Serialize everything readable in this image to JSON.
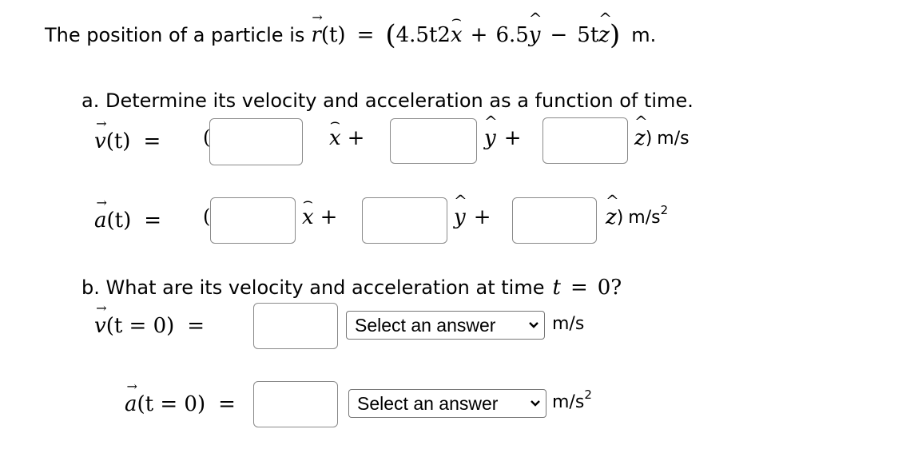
{
  "problem": {
    "intro_text": "The position of a particle is",
    "position_lhs": "r",
    "position_arg": "(t)",
    "equals": "=",
    "open_paren": "(",
    "term1_coef": "4.5t",
    "term1_exp": "2",
    "term1_unit_vec": "x",
    "plus1": "+",
    "term2_coef": "6.5",
    "term2_unit_vec": "y",
    "minus": "−",
    "term3_coef": "5t",
    "term3_unit_vec": "z",
    "close_paren": ")",
    "unit": "m."
  },
  "part_a": {
    "prompt": "a. Determine its velocity and acceleration as a function of time.",
    "velocity": {
      "lhs_symbol": "v",
      "lhs_arg": "(t)",
      "equals": "=",
      "open_paren": "(",
      "x_label": "x",
      "y_label": "y",
      "z_label": "z",
      "plus": "+",
      "close_paren": ")",
      "unit": "m/s",
      "inputs": [
        {
          "value": "",
          "placeholder": ""
        },
        {
          "value": "",
          "placeholder": ""
        },
        {
          "value": "",
          "placeholder": ""
        }
      ]
    },
    "acceleration": {
      "lhs_symbol": "a",
      "lhs_arg": "(t)",
      "equals": "=",
      "open_paren": "(",
      "x_label": "x",
      "y_label": "y",
      "z_label": "z",
      "plus": "+",
      "close_paren": ")",
      "unit": "m/s",
      "unit_exp": "2",
      "inputs": [
        {
          "value": "",
          "placeholder": ""
        },
        {
          "value": "",
          "placeholder": ""
        },
        {
          "value": "",
          "placeholder": ""
        }
      ]
    }
  },
  "part_b": {
    "prompt_text": "b. What are its velocity and acceleration at time",
    "prompt_var": "t",
    "prompt_eq": "=",
    "prompt_val": "0?",
    "velocity": {
      "lhs_symbol": "v",
      "lhs_arg": "(t = 0)",
      "equals": "=",
      "input": {
        "value": "",
        "placeholder": ""
      },
      "select_label": "Select an answer",
      "unit": "m/s"
    },
    "acceleration": {
      "lhs_symbol": "a",
      "lhs_arg": "(t = 0)",
      "equals": "=",
      "input": {
        "value": "",
        "placeholder": ""
      },
      "select_label": "Select an answer",
      "unit": "m/s",
      "unit_exp": "2"
    }
  },
  "icons": {
    "hat": "^",
    "wide_hat": "⌢",
    "vector_arrow": "→",
    "chevron": "⌄"
  }
}
